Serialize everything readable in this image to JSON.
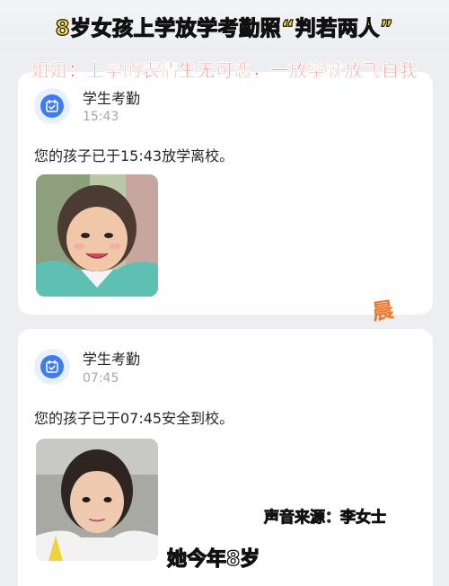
{
  "overlay": {
    "headline": "8岁女孩上学放学考勤照“判若两人”",
    "subline": "姐姐：上学的表情生无可恋，一放学就放飞自我",
    "watermark": "晨",
    "source": "声音来源：李女士",
    "caption": "她今年8岁"
  },
  "notifications": [
    {
      "app_name": "学生考勤",
      "time": "15:43",
      "message": "您的孩子已于15:43放学离校。",
      "icon": "calendar-check-icon"
    },
    {
      "app_name": "学生考勤",
      "time": "07:45",
      "message": "您的孩子已于07:45安全到校。",
      "icon": "calendar-check-icon"
    }
  ],
  "colors": {
    "accent_blue": "#3d7cf2",
    "headline_yellow": "#f6de2c",
    "subline_red": "#e8271f",
    "watermark_orange": "#f0762e"
  }
}
